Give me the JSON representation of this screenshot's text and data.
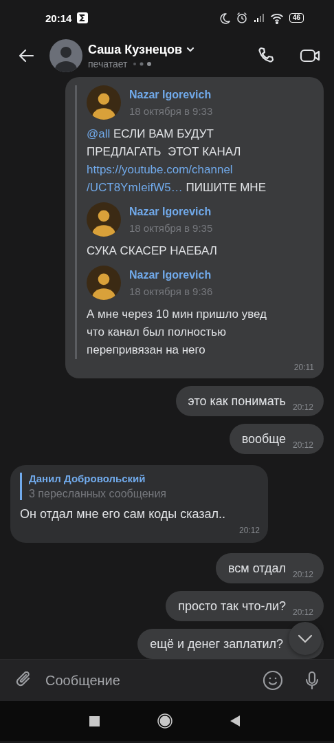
{
  "status_bar": {
    "time": "20:14",
    "battery": "46"
  },
  "header": {
    "name": "Саша Кузнецов",
    "status": "печатает"
  },
  "messages": [
    {
      "kind": "forwarded",
      "outgoing": true,
      "time": "20:11",
      "items": [
        {
          "author": "Nazar Igorevich",
          "date": "18 октября в 9:33",
          "parts": [
            {
              "kind": "mention",
              "text": "@all"
            },
            {
              "kind": "plain",
              "text": " ЕСЛИ ВАМ БУДУТ ПРЕДЛАГАТЬ  ЭТОТ КАНАЛ "
            },
            {
              "kind": "link",
              "text": "https://youtube.com/channel"
            },
            {
              "kind": "link",
              "text": "/UCT8YmIeifW5…"
            },
            {
              "kind": "plain",
              "text": " ПИШИТЕ МНЕ"
            }
          ]
        },
        {
          "author": "Nazar Igorevich",
          "date": "18 октября в 9:35",
          "parts": [
            {
              "kind": "plain",
              "text": "СУКА СКАСЕР НАЕБАЛ"
            }
          ]
        },
        {
          "author": "Nazar Igorevich",
          "date": "18 октября в 9:36",
          "parts": [
            {
              "kind": "plain",
              "text": "А мне через 10 мин пришло увед что канал был полностью перепривязан на него"
            }
          ]
        }
      ]
    },
    {
      "kind": "text",
      "outgoing": true,
      "text": "это как понимать",
      "time": "20:12"
    },
    {
      "kind": "text",
      "outgoing": true,
      "text": "вообще",
      "time": "20:12"
    },
    {
      "kind": "reply",
      "outgoing": false,
      "quote_author": "Данил Добровольский",
      "quote_text": "3 пересланных сообщения",
      "text": "Он отдал мне его сам коды сказал..",
      "time": "20:12"
    },
    {
      "kind": "text",
      "outgoing": true,
      "text": "всм отдал",
      "time": "20:12"
    },
    {
      "kind": "text",
      "outgoing": true,
      "text": "просто так что-ли?",
      "time": "20:12"
    },
    {
      "kind": "text",
      "outgoing": true,
      "text": "ещё и денег заплатил?"
    }
  ],
  "composer": {
    "placeholder": "Сообщение"
  }
}
